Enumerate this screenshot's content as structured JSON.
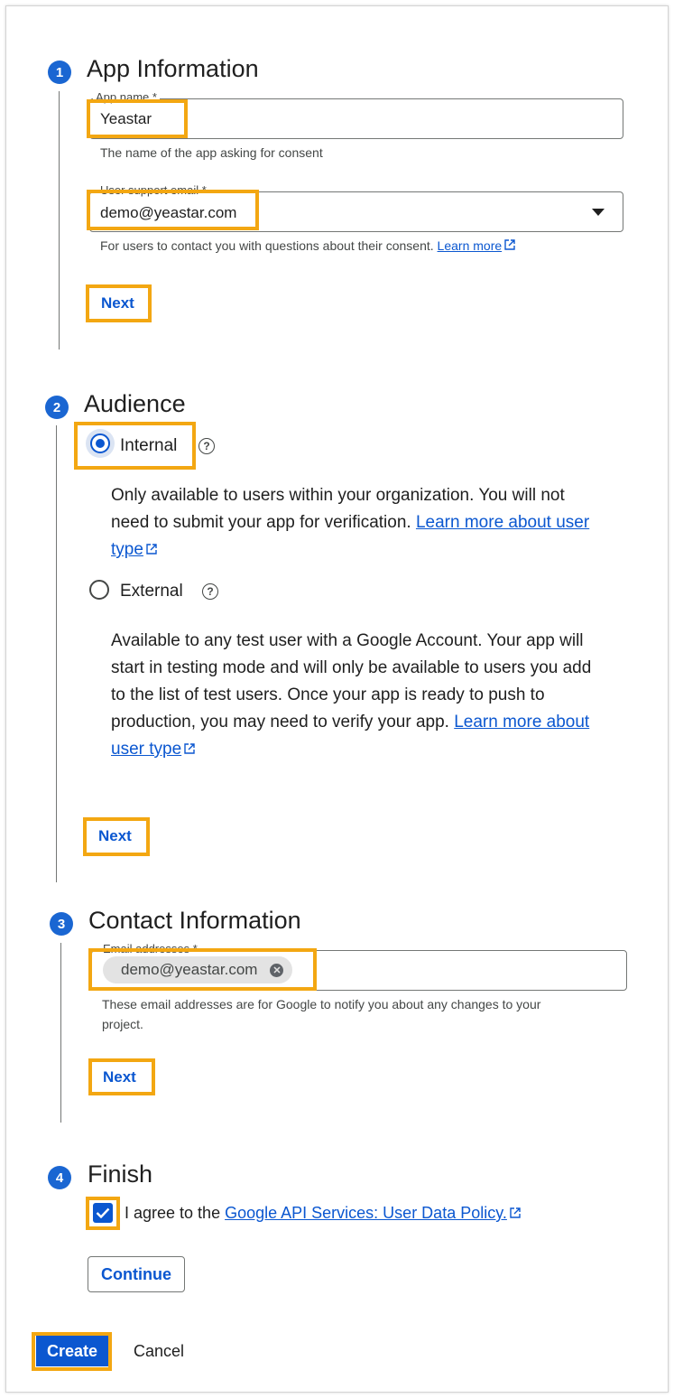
{
  "steps": {
    "app_info": {
      "number": "1",
      "title": "App Information",
      "app_name_label": "App name *",
      "app_name_value": "Yeastar",
      "app_name_helper": "The name of the app asking for consent",
      "support_email_label": "User support email *",
      "support_email_value": "demo@yeastar.com",
      "support_email_helper": "For users to contact you with questions about their consent.",
      "learn_more": "Learn more",
      "next_label": "Next"
    },
    "audience": {
      "number": "2",
      "title": "Audience",
      "internal_label": "Internal",
      "internal_selected": true,
      "internal_desc_line1": "Only available to users within your organization. You will not",
      "internal_desc_line2": "need to submit your app for verification.",
      "internal_link_part1": "Learn more about user",
      "internal_link_part2": "type",
      "external_label": "External",
      "external_selected": false,
      "external_desc_line1": "Available to any test user with a Google Account. Your app will",
      "external_desc_line2": "start in testing mode and will only be available to users you add",
      "external_desc_line3": "to the list of test users. Once your app is ready to push to",
      "external_desc_line4": "production, you may need to verify your app.",
      "external_link_part1": "Learn more about",
      "external_link_part2": "user type",
      "next_label": "Next"
    },
    "contact": {
      "number": "3",
      "title": "Contact Information",
      "email_label": "Email addresses *",
      "email_chip": "demo@yeastar.com",
      "helper_line1": "These email addresses are for Google to notify you about any changes to your",
      "helper_line2": "project.",
      "next_label": "Next"
    },
    "finish": {
      "number": "4",
      "title": "Finish",
      "agree_text": "I agree to the",
      "policy_link": "Google API Services: User Data Policy.",
      "agreed": true,
      "continue_label": "Continue"
    }
  },
  "footer": {
    "create_label": "Create",
    "cancel_label": "Cancel"
  },
  "colors": {
    "accent": "#0b57d0",
    "step_badge": "#1a66d2",
    "highlight": "#f3a712"
  }
}
